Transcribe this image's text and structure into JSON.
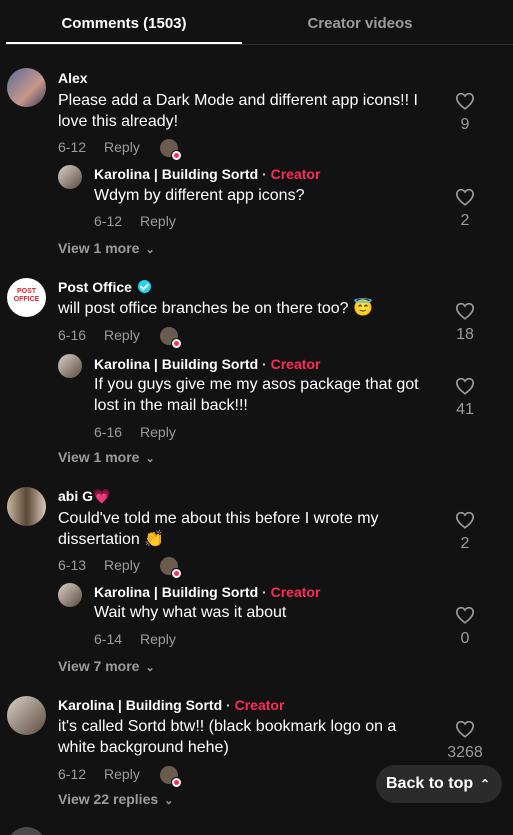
{
  "tabs": {
    "comments": "Comments (1503)",
    "creator_videos": "Creator videos"
  },
  "comments": [
    {
      "name": "Alex",
      "text": "Please add a Dark Mode and different app icons!! I love this already!",
      "date": "6-12",
      "reply_label": "Reply",
      "likes": "9",
      "reply": {
        "name": "Karolina | Building Sortd",
        "dot": " · ",
        "creator": "Creator",
        "text": "Wdym by different app icons?",
        "date": "6-12",
        "reply_label": "Reply",
        "likes": "2"
      },
      "view_more": "View 1 more"
    },
    {
      "name": "Post Office",
      "avatar_text": "POST OFFICE",
      "text": "will post office branches be on there too? 😇",
      "date": "6-16",
      "reply_label": "Reply",
      "likes": "18",
      "reply": {
        "name": "Karolina | Building Sortd",
        "dot": " · ",
        "creator": "Creator",
        "text": "If you guys give me my asos package that got lost in the mail back!!!",
        "date": "6-16",
        "reply_label": "Reply",
        "likes": "41"
      },
      "view_more": "View 1 more"
    },
    {
      "name": "abi G💗",
      "text": "Could've told me about this before I wrote my dissertation 👏",
      "date": "6-13",
      "reply_label": "Reply",
      "likes": "2",
      "reply": {
        "name": "Karolina | Building Sortd",
        "dot": " · ",
        "creator": "Creator",
        "text": "Wait why what was it about",
        "date": "6-14",
        "reply_label": "Reply",
        "likes": "0"
      },
      "view_more": "View 7 more"
    },
    {
      "name": "Karolina | Building Sortd",
      "dot": " · ",
      "creator": "Creator",
      "text": "it's called Sortd btw!! (black bookmark logo on a white background hehe)",
      "date": "6-12",
      "reply_label": "Reply",
      "likes": "3268",
      "view_more": "View 22 replies"
    }
  ],
  "back_to_top": "Back to top",
  "colors": {
    "background": "#121212",
    "creator": "#fe2c55",
    "muted": "#9c9c9c"
  }
}
